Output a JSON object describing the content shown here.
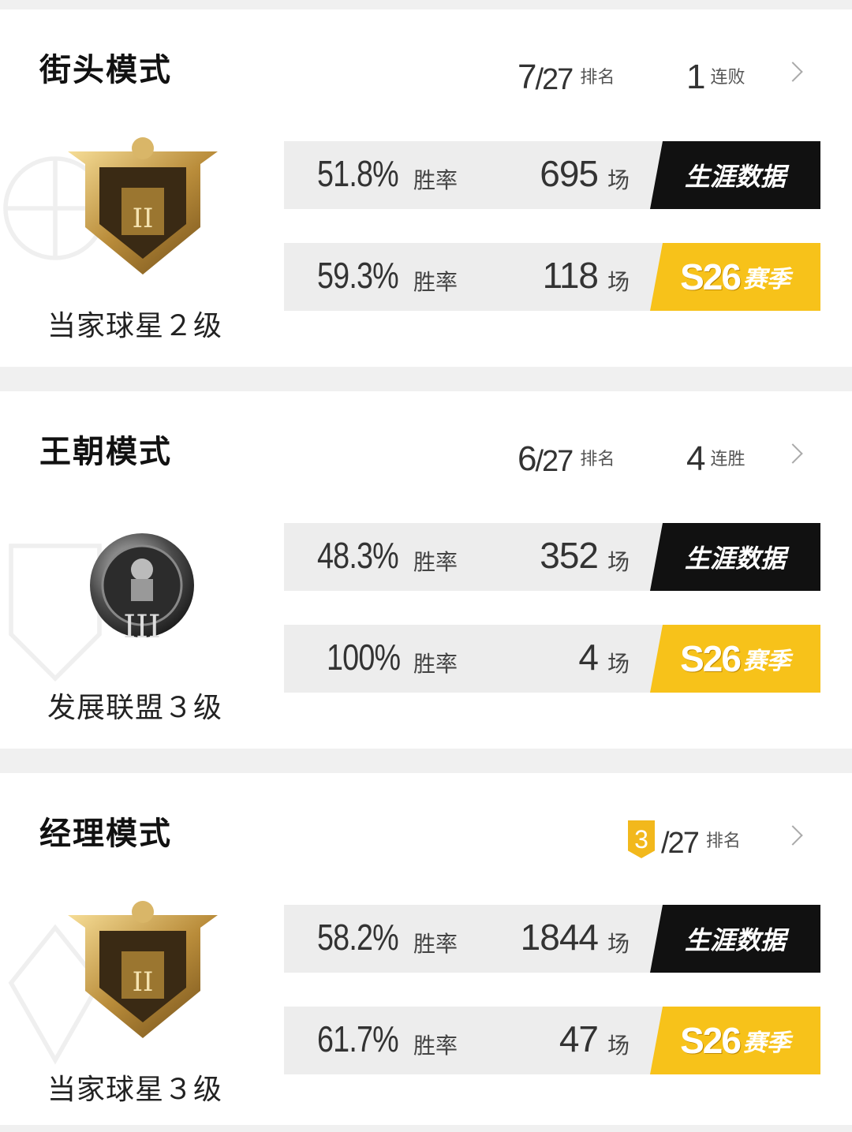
{
  "modes": [
    {
      "title": "街头模式",
      "rank": "7",
      "rank_total": "/27",
      "rank_label": "排名",
      "streak_num": "1",
      "streak_label": "连败",
      "badge_name": "当家球星２级",
      "badge_type": "gold-shield-badge",
      "career": {
        "rate": "51.8%",
        "rate_label": "胜率",
        "games": "695",
        "games_label": "场",
        "tag": "生涯数据"
      },
      "season": {
        "rate": "59.3%",
        "rate_label": "胜率",
        "games": "118",
        "games_label": "场",
        "tag_code": "S26",
        "tag_word": "赛季"
      }
    },
    {
      "title": "王朝模式",
      "rank": "6",
      "rank_total": "/27",
      "rank_label": "排名",
      "streak_num": "4",
      "streak_label": "连胜",
      "badge_name": "发展联盟３级",
      "badge_type": "silver-round-badge",
      "career": {
        "rate": "48.3%",
        "rate_label": "胜率",
        "games": "352",
        "games_label": "场",
        "tag": "生涯数据"
      },
      "season": {
        "rate": "100%",
        "rate_label": "胜率",
        "games": "4",
        "games_label": "场",
        "tag_code": "S26",
        "tag_word": "赛季"
      }
    },
    {
      "title": "经理模式",
      "rank": "3",
      "rank_total": "/27",
      "rank_label": "排名",
      "badge_name": "当家球星３级",
      "badge_type": "gold-shield-badge",
      "career": {
        "rate": "58.2%",
        "rate_label": "胜率",
        "games": "1844",
        "games_label": "场",
        "tag": "生涯数据"
      },
      "season": {
        "rate": "61.7%",
        "rate_label": "胜率",
        "games": "47",
        "games_label": "场",
        "tag_code": "S26",
        "tag_word": "赛季"
      }
    }
  ],
  "colors": {
    "accent_gold": "#f7c21a",
    "career_tag_bg": "#111111",
    "row_bg": "#ededed",
    "divider": "#f0f0f0"
  }
}
